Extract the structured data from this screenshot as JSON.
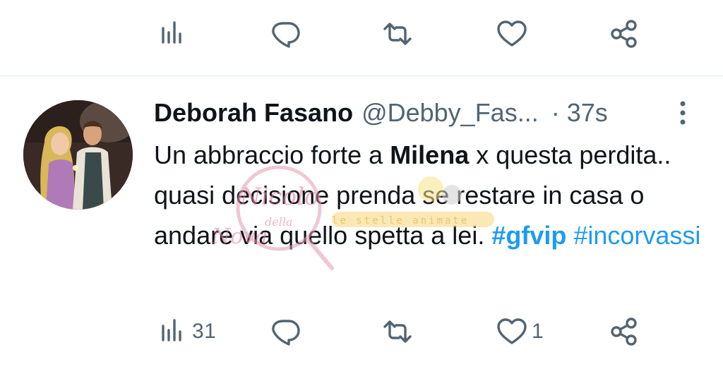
{
  "top_actions": {
    "views_icon": "bar-chart-icon",
    "reply_icon": "reply-icon",
    "retweet_icon": "retweet-icon",
    "like_icon": "heart-icon",
    "share_icon": "share-icon"
  },
  "tweet": {
    "author_name": "Deborah Fasano",
    "author_handle": "@Debby_Fas...",
    "separator": "·",
    "time": "37s",
    "text_parts": {
      "p1": "Un abbraccio forte a ",
      "p2": "Milena",
      "p3": " x questa perdita.. quasi decisione prenda se restare in casa o andare via quello spetta a lei. ",
      "hashtag1": "#gfvip",
      "space": " ",
      "hashtag2": "#incorvassi"
    },
    "stats": {
      "views": "31",
      "replies": "",
      "retweets": "",
      "likes": "1"
    }
  },
  "watermark": {
    "script_text": "Nicolo della Nova",
    "banner_text": "le stelle animate"
  },
  "colors": {
    "text_primary": "#0f1419",
    "text_secondary": "#536471",
    "accent": "#1d9bf0",
    "divider": "#e1e6ea"
  }
}
